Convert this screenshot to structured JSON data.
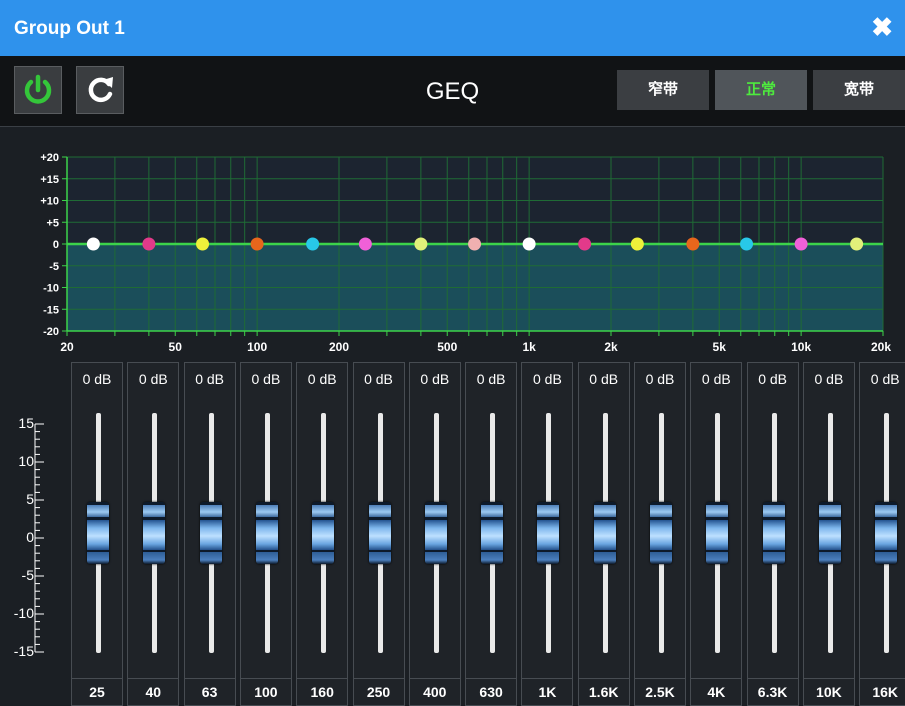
{
  "window": {
    "title": "Group Out 1",
    "close_glyph": "✖"
  },
  "toolbar": {
    "power_icon": "power-icon",
    "refresh_icon": "refresh-icon",
    "title": "GEQ",
    "power_color": "#34c63a",
    "bandwidth": [
      {
        "label": "窄带",
        "active": false
      },
      {
        "label": "正常",
        "active": true
      },
      {
        "label": "宽带",
        "active": false
      }
    ]
  },
  "graph": {
    "db_labels": [
      "+20",
      "+15",
      "+10",
      "+5",
      "0",
      "-5",
      "-10",
      "-15",
      "-20"
    ],
    "freq_labels": [
      {
        "f": 20,
        "t": "20"
      },
      {
        "f": 50,
        "t": "50"
      },
      {
        "f": 100,
        "t": "100"
      },
      {
        "f": 200,
        "t": "200"
      },
      {
        "f": 500,
        "t": "500"
      },
      {
        "f": 1000,
        "t": "1k"
      },
      {
        "f": 2000,
        "t": "2k"
      },
      {
        "f": 5000,
        "t": "5k"
      },
      {
        "f": 10000,
        "t": "10k"
      },
      {
        "f": 20000,
        "t": "20k"
      }
    ],
    "line_color": "#3cd34a",
    "fill_color": "#1b4e5a"
  },
  "fader_scale": [
    "15",
    "10",
    "5",
    "0",
    "-5",
    "-10",
    "-15"
  ],
  "bands": [
    {
      "freq_hz": 25,
      "label": "25",
      "gain": "0 dB",
      "gain_db": 0,
      "color": "#ffffff"
    },
    {
      "freq_hz": 40,
      "label": "40",
      "gain": "0 dB",
      "gain_db": 0,
      "color": "#e23a8a"
    },
    {
      "freq_hz": 63,
      "label": "63",
      "gain": "0 dB",
      "gain_db": 0,
      "color": "#eef13a"
    },
    {
      "freq_hz": 100,
      "label": "100",
      "gain": "0 dB",
      "gain_db": 0,
      "color": "#e8661c"
    },
    {
      "freq_hz": 160,
      "label": "160",
      "gain": "0 dB",
      "gain_db": 0,
      "color": "#28c8e8"
    },
    {
      "freq_hz": 250,
      "label": "250",
      "gain": "0 dB",
      "gain_db": 0,
      "color": "#f060d8"
    },
    {
      "freq_hz": 400,
      "label": "400",
      "gain": "0 dB",
      "gain_db": 0,
      "color": "#e2f07a"
    },
    {
      "freq_hz": 630,
      "label": "630",
      "gain": "0 dB",
      "gain_db": 0,
      "color": "#f0b0b0"
    },
    {
      "freq_hz": 1000,
      "label": "1K",
      "gain": "0 dB",
      "gain_db": 0,
      "color": "#ffffff"
    },
    {
      "freq_hz": 1600,
      "label": "1.6K",
      "gain": "0 dB",
      "gain_db": 0,
      "color": "#e23a8a"
    },
    {
      "freq_hz": 2500,
      "label": "2.5K",
      "gain": "0 dB",
      "gain_db": 0,
      "color": "#eef13a"
    },
    {
      "freq_hz": 4000,
      "label": "4K",
      "gain": "0 dB",
      "gain_db": 0,
      "color": "#e8661c"
    },
    {
      "freq_hz": 6300,
      "label": "6.3K",
      "gain": "0 dB",
      "gain_db": 0,
      "color": "#28c8e8"
    },
    {
      "freq_hz": 10000,
      "label": "10K",
      "gain": "0 dB",
      "gain_db": 0,
      "color": "#f060d8"
    },
    {
      "freq_hz": 16000,
      "label": "16K",
      "gain": "0 dB",
      "gain_db": 0,
      "color": "#e2f07a"
    }
  ]
}
